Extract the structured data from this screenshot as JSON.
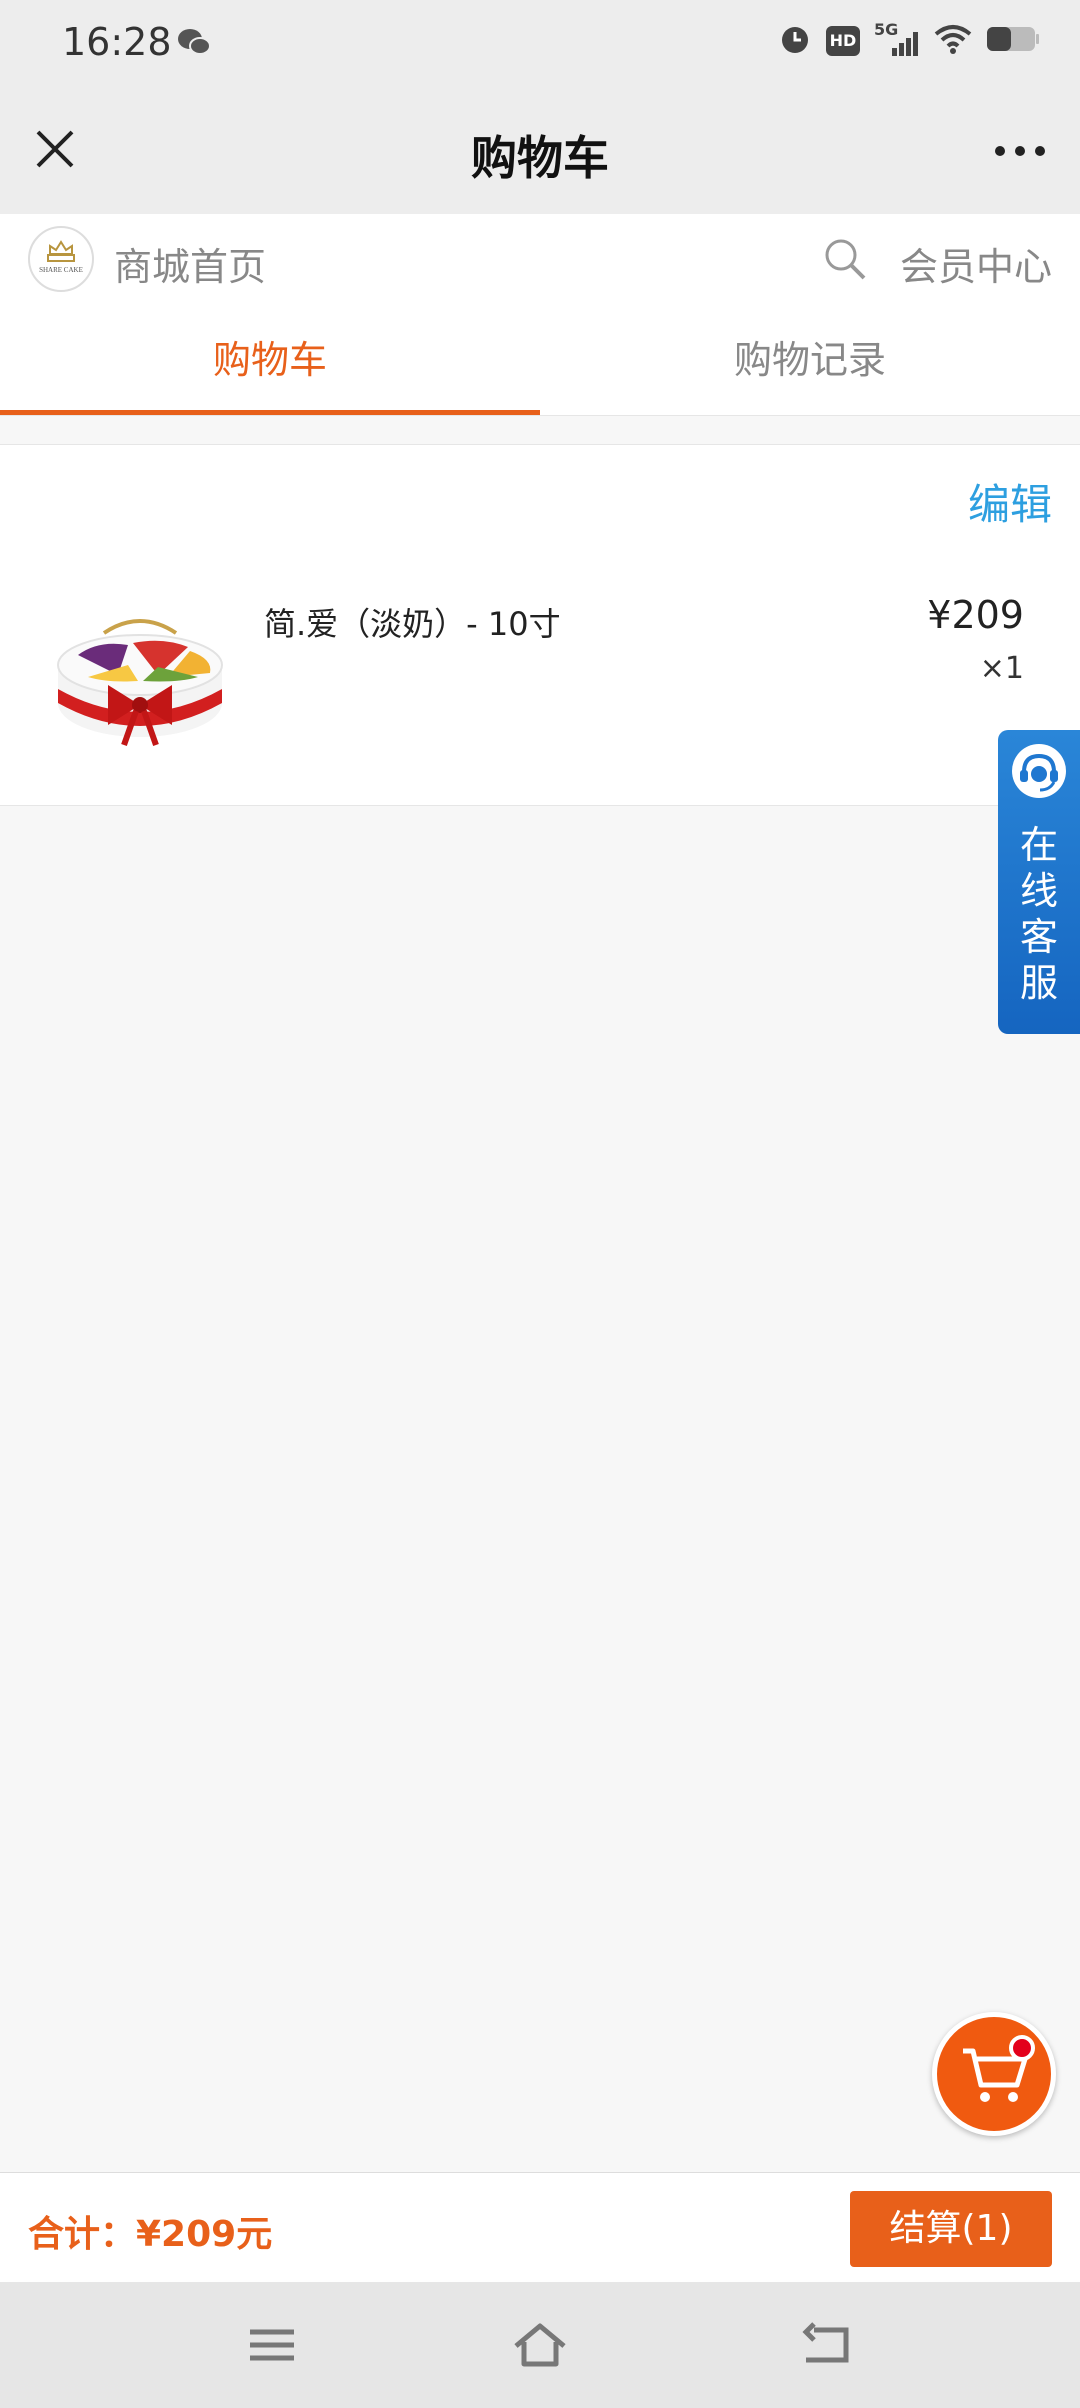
{
  "status_bar": {
    "time": "16:28",
    "icons": [
      "wechat-icon",
      "alarm-icon",
      "hd-icon",
      "signal-5g-icon",
      "wifi-icon",
      "battery-icon"
    ],
    "network_label": "5G",
    "hd_label": "HD"
  },
  "title_bar": {
    "title": "购物车",
    "close_icon": "close-icon",
    "more_icon": "more-icon"
  },
  "store_header": {
    "home_label": "商城首页",
    "member_center_label": "会员中心",
    "logo_text": "SHARE CAKE"
  },
  "tabs": [
    {
      "label": "购物车",
      "active": true
    },
    {
      "label": "购物记录",
      "active": false
    }
  ],
  "cart": {
    "edit_label": "编辑",
    "items": [
      {
        "name": "简.爱（淡奶）- 10寸",
        "price": "¥209",
        "quantity": "×1"
      }
    ]
  },
  "customer_service": {
    "label": "在线客服"
  },
  "footer": {
    "total_label": "合计：¥209元",
    "checkout_label": "结算(1)"
  },
  "colors": {
    "accent": "#e8601a",
    "link": "#2d9fe0",
    "service": "#1f77d0"
  }
}
